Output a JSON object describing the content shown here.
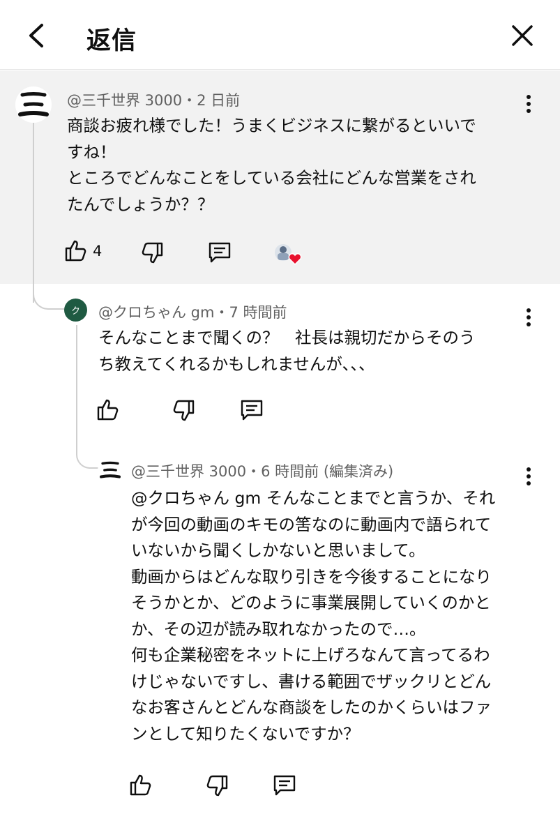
{
  "header": {
    "title": "返信",
    "back_icon": "chevron-left-icon",
    "close_icon": "close-icon"
  },
  "comments": [
    {
      "avatar_text": "三",
      "meta": "@三千世界 3000・2 日前",
      "lines": [
        "商談お疲れ様でした！うまくビジネスに繋がるといいで",
        "すね！",
        "ところでどんなことをしている会社にどんな営業をされ",
        "たんでしょうか？？"
      ],
      "like_count": "4"
    },
    {
      "avatar_text": "ク",
      "meta": "@クロちゃん gm・7 時間前",
      "lines": [
        "そんなことまで聞くの？　社長は親切だからそのう",
        "ち教えてくれるかもしれませんが、、、"
      ]
    },
    {
      "avatar_text": "三",
      "meta": "@三千世界 3000・6 時間前 (編集済み)",
      "lines": [
        "@クロちゃん gm そんなことまでと言うか、それ",
        "が今回の動画のキモの筈なのに動画内で語られて",
        "いないから聞くしかないと思いまして。",
        "動画からはどんな取り引きを今後することになり",
        "そうかとか、どのように事業展開していくのかと",
        "か、その辺が読み取れなかったので…。",
        "何も企業秘密をネットに上げろなんて言ってるわ",
        "けじゃないですし、書ける範囲でザックリとどん",
        "なお客さんとどんな商談をしたのかくらいはファ",
        "ンとして知りたくないですか？"
      ]
    }
  ],
  "colors": {
    "highlight_bg": "#f2f2f2",
    "meta_text": "#606060",
    "heart": "#e8112d",
    "avatar_green": "#1f5a42"
  }
}
